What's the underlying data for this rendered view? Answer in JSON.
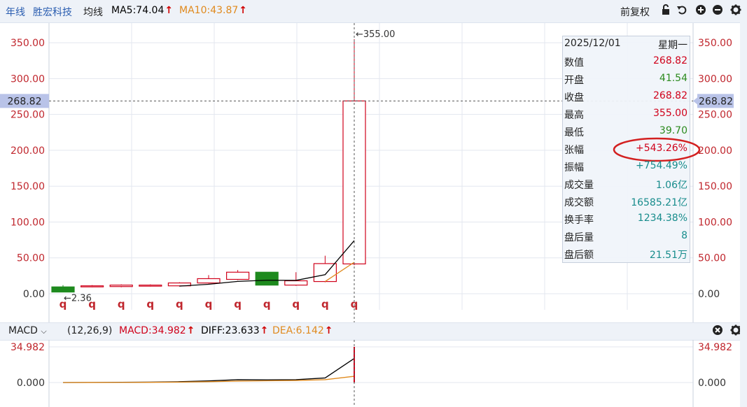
{
  "toolbar": {
    "period": "年线",
    "stock_name": "胜宏科技",
    "avg_label": "均线",
    "ma5": "MA5:74.04",
    "ma10": "MA10:43.87",
    "adjust": "前复权",
    "icons": [
      "lock-icon",
      "undo-icon",
      "zoom-in-icon",
      "zoom-out-icon",
      "gear-icon"
    ]
  },
  "price_axis": {
    "left_ticks": [
      "350.00",
      "300.00",
      "250.00",
      "200.00",
      "150.00",
      "100.00",
      "50.00",
      "0.00"
    ],
    "right_ticks": [
      "350.00",
      "300.00",
      "250.00",
      "200.00",
      "150.00",
      "100.00",
      "50.00",
      "0.00"
    ],
    "crosshair_value": "268.82",
    "high_marker": "←355.00",
    "low_marker": "←2.36"
  },
  "info_panel": {
    "date": "2025/12/01",
    "weekday": "星期一",
    "rows": [
      {
        "k": "数值",
        "v": "268.82",
        "color": "#d0021b"
      },
      {
        "k": "开盘",
        "v": "41.54",
        "color": "#2b8a1e"
      },
      {
        "k": "收盘",
        "v": "268.82",
        "color": "#d0021b"
      },
      {
        "k": "最高",
        "v": "355.00",
        "color": "#d0021b"
      },
      {
        "k": "最低",
        "v": "39.70",
        "color": "#2b8a1e"
      },
      {
        "k": "张幅",
        "v": "+543.26%",
        "color": "#d0021b"
      },
      {
        "k": "振幅",
        "v": "+754.49%",
        "color": "#178c8c"
      },
      {
        "k": "成交量",
        "v": "1.06亿",
        "color": "#178c8c"
      },
      {
        "k": "成交额",
        "v": "16585.21亿",
        "color": "#178c8c"
      },
      {
        "k": "换手率",
        "v": "1234.38%",
        "color": "#178c8c"
      },
      {
        "k": "盘后量",
        "v": "8",
        "color": "#178c8c"
      },
      {
        "k": "盘后额",
        "v": "21.51万",
        "color": "#178c8c"
      }
    ]
  },
  "marker_glyph": "q",
  "macd_bar": {
    "indicator": "MACD",
    "params": "(12,26,9)",
    "macd": "MACD:34.982",
    "diff": "DIFF:23.633",
    "dea": "DEA:6.142"
  },
  "macd_axis": {
    "left_ticks": [
      "34.982",
      "0.000"
    ],
    "right_ticks": [
      "34.982",
      "0.000"
    ]
  },
  "colors": {
    "up": "#d0021b",
    "down": "#1e8a1e",
    "ma5": "#000000",
    "ma10": "#e08a1e",
    "grid": "#e3e7ef",
    "highlight": "#b9c3e8"
  },
  "chart_data": {
    "type": "candlestick",
    "ylim": [
      0,
      355
    ],
    "candles": [
      {
        "o": 9.5,
        "h": 12,
        "l": 2.36,
        "c": 2.36
      },
      {
        "o": 10,
        "h": 12,
        "l": 9,
        "c": 11
      },
      {
        "o": 10,
        "h": 13,
        "l": 9,
        "c": 12
      },
      {
        "o": 11,
        "h": 13,
        "l": 10,
        "c": 12
      },
      {
        "o": 11,
        "h": 16,
        "l": 10,
        "c": 15
      },
      {
        "o": 15,
        "h": 26,
        "l": 14,
        "c": 21
      },
      {
        "o": 20,
        "h": 33,
        "l": 19,
        "c": 30
      },
      {
        "o": 30,
        "h": 30,
        "l": 12,
        "c": 12
      },
      {
        "o": 12,
        "h": 30,
        "l": 11,
        "c": 18
      },
      {
        "o": 17,
        "h": 53,
        "l": 16,
        "c": 42
      },
      {
        "o": 41.54,
        "h": 355,
        "l": 39.7,
        "c": 268.82
      }
    ],
    "ma5": [
      null,
      null,
      null,
      null,
      10.6,
      13.2,
      17.2,
      18.8,
      18.6,
      26.6,
      74.04
    ],
    "ma10": [
      null,
      null,
      null,
      null,
      null,
      null,
      null,
      null,
      null,
      null,
      43.87
    ],
    "macd": {
      "ylim": [
        -2,
        34.982
      ],
      "diff": [
        0,
        0.1,
        0.2,
        0.4,
        0.8,
        1.6,
        2.8,
        2.6,
        2.8,
        4.5,
        23.633
      ],
      "dea": [
        0,
        0.05,
        0.1,
        0.2,
        0.4,
        0.8,
        1.4,
        1.7,
        2.0,
        2.8,
        6.142
      ],
      "hist_last": 34.982
    }
  }
}
